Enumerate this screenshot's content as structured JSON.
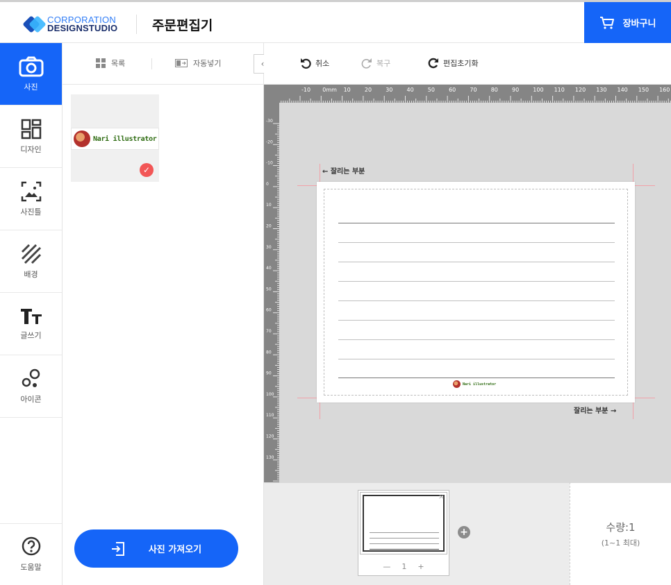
{
  "header": {
    "logo_line1": "CORPORATION",
    "logo_line2": "DESIGNSTUDIO",
    "title": "주문편집기",
    "cart_label": "장바구니",
    "accent": "#1565f8"
  },
  "nav": {
    "items": [
      {
        "label": "사진",
        "icon": "camera-icon",
        "active": true
      },
      {
        "label": "디자인",
        "icon": "layout-icon"
      },
      {
        "label": "사진틀",
        "icon": "photo-frame-icon"
      },
      {
        "label": "배경",
        "icon": "stripes-icon"
      },
      {
        "label": "글쓰기",
        "icon": "text-icon"
      },
      {
        "label": "아이콘",
        "icon": "shapes-icon"
      }
    ],
    "help_label": "도움말"
  },
  "panel": {
    "tab_list": "목록",
    "tab_autofill": "자동넣기",
    "collapse": "‹",
    "photo_caption": "Nari illustrator",
    "import_label": "사진 가져오기"
  },
  "toolbar": {
    "undo": "취소",
    "redo": "복구",
    "reset": "편집초기화"
  },
  "canvas": {
    "ruler_top": [
      "-10",
      "0mm",
      "10",
      "20",
      "30",
      "40",
      "50",
      "60",
      "70",
      "80",
      "90",
      "100",
      "110",
      "120",
      "130",
      "140",
      "150",
      "160"
    ],
    "ruler_left": [
      "-30",
      "-20",
      "-10",
      "0",
      "10",
      "20",
      "30",
      "40",
      "50",
      "60",
      "70",
      "80",
      "90",
      "100",
      "110",
      "120",
      "130"
    ],
    "cut_label_left": "← 잘리는 부분",
    "cut_label_right": "잘리는 부분 →",
    "paper_caption": "Nari illustrator",
    "crop_color": "#f2a0a8"
  },
  "pages": {
    "current": "1",
    "minus": "—",
    "plus": "+",
    "close": "×",
    "add": "+"
  },
  "quantity": {
    "label": "수량:1",
    "range": "(1~1 최대)"
  }
}
